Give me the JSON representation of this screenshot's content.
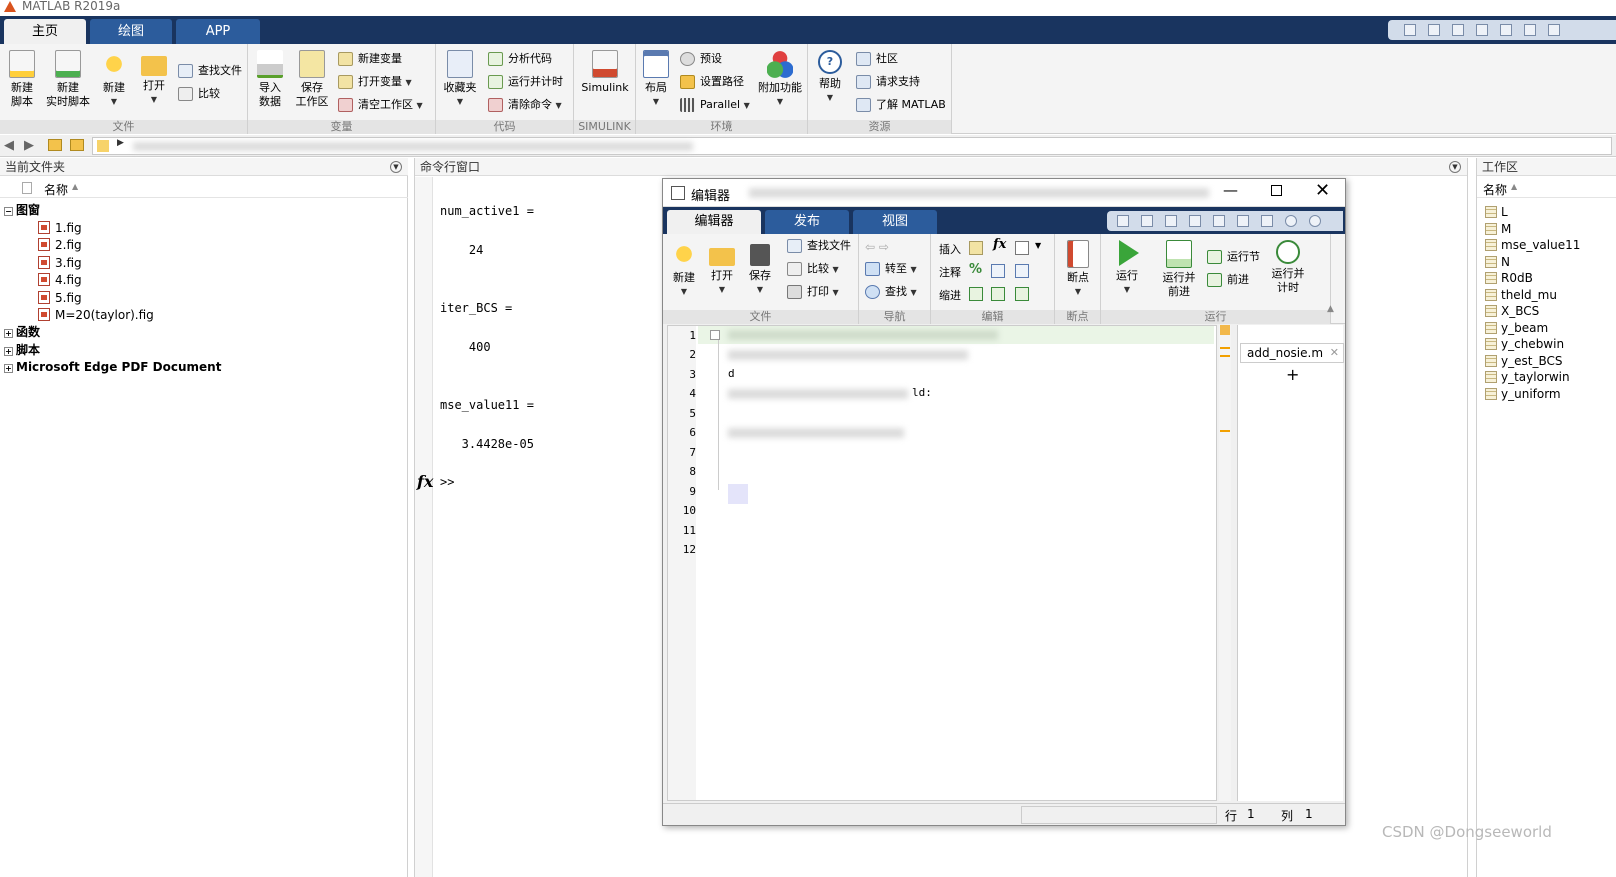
{
  "window": {
    "title": "MATLAB R2019a"
  },
  "main_tabs": [
    {
      "label": "主页",
      "active": true
    },
    {
      "label": "绘图"
    },
    {
      "label": "APP"
    }
  ],
  "ribbon": {
    "file": {
      "label": "文件",
      "new_script": "新建\n脚本",
      "new_live": "新建\n实时脚本",
      "new": "新建",
      "open": "打开",
      "find_files": "查找文件",
      "compare": "比较"
    },
    "variable": {
      "label": "变量",
      "import": "导入\n数据",
      "save_ws": "保存\n工作区",
      "new_var": "新建变量",
      "open_var": "打开变量",
      "clear_ws": "清空工作区"
    },
    "code": {
      "label": "代码",
      "favorites": "收藏夹",
      "analyze": "分析代码",
      "run_time": "运行并计时",
      "clear_cmd": "清除命令"
    },
    "simulink": {
      "label": "SIMULINK",
      "simulink": "Simulink"
    },
    "env": {
      "label": "环境",
      "layout": "布局",
      "prefs": "预设",
      "set_path": "设置路径",
      "parallel": "Parallel",
      "addons": "附加功能"
    },
    "resources": {
      "label": "资源",
      "help": "帮助",
      "community": "社区",
      "support": "请求支持",
      "learn": "了解 MATLAB"
    }
  },
  "current_folder": {
    "title": "当前文件夹",
    "col_name": "名称",
    "groups": [
      {
        "name": "图窗",
        "expanded": true,
        "items": [
          "1.fig",
          "2.fig",
          "3.fig",
          "4.fig",
          "5.fig",
          "M=20(taylor).fig"
        ]
      },
      {
        "name": "函数"
      },
      {
        "name": "脚本"
      },
      {
        "name": "Microsoft Edge PDF Document"
      }
    ]
  },
  "command_window": {
    "title": "命令行窗口",
    "lines": [
      {
        "text": "num_active1 ="
      },
      {
        "text": "    24"
      },
      {
        "text": "iter_BCS ="
      },
      {
        "text": "    400"
      },
      {
        "text": "mse_value11 ="
      },
      {
        "text": "   3.4428e-05"
      }
    ],
    "prompt": ">>",
    "fx": "fx"
  },
  "editor": {
    "title": "编辑器",
    "tabs": [
      {
        "label": "编辑器",
        "active": true
      },
      {
        "label": "发布"
      },
      {
        "label": "视图"
      }
    ],
    "ribbon": {
      "file": {
        "label": "文件",
        "new": "新建",
        "open": "打开",
        "save": "保存",
        "find_files": "查找文件",
        "compare": "比较",
        "print": "打印"
      },
      "nav": {
        "label": "导航",
        "goto": "转至",
        "find": "查找"
      },
      "edit": {
        "label": "编辑",
        "insert": "插入",
        "comment": "注释",
        "indent": "缩进",
        "fx": "fx"
      },
      "breakpoints": {
        "label": "断点",
        "bp": "断点"
      },
      "run": {
        "label": "运行",
        "run": "运行",
        "run_advance": "运行并\n前进",
        "run_section": "运行节",
        "advance": "前进",
        "run_time": "运行并\n计时"
      }
    },
    "line_numbers": [
      "1",
      "2",
      "3",
      "4",
      "5",
      "6",
      "7",
      "8",
      "9",
      "10",
      "11",
      "12"
    ],
    "visible_code": [
      {
        "line": 3,
        "text": "d"
      },
      {
        "line": 4,
        "text": "ld:"
      }
    ],
    "file_tab": "add_nosie.m",
    "add_tab": "+",
    "status": {
      "row_label": "行",
      "row": "1",
      "col_label": "列",
      "col": "1"
    }
  },
  "workspace": {
    "title": "工作区",
    "col_name": "名称",
    "vars": [
      "L",
      "M",
      "mse_value11",
      "N",
      "R0dB",
      "theld_mu",
      "X_BCS",
      "y_beam",
      "y_chebwin",
      "y_est_BCS",
      "y_taylorwin",
      "y_uniform"
    ]
  },
  "watermark": "CSDN @Dongseeworld",
  "colors": {
    "tabbar": "#19345f",
    "tab": "#2c5c9c",
    "ribbon": "#f4f4f4"
  }
}
